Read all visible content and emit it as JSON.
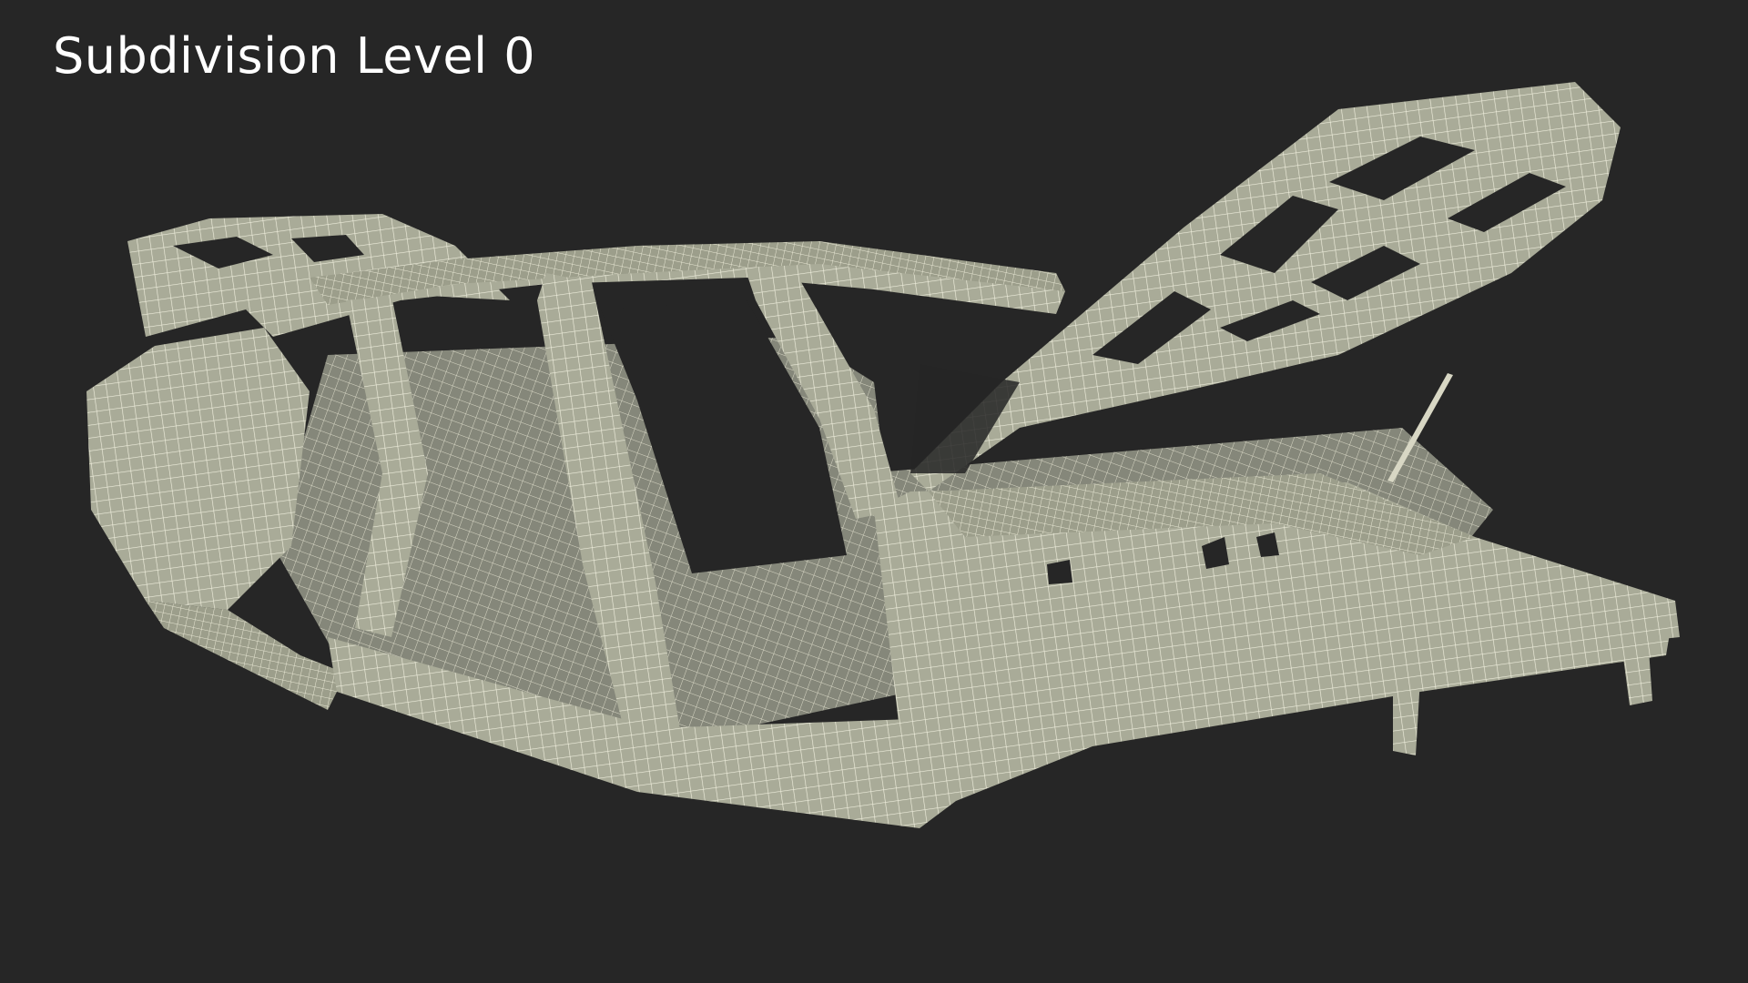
{
  "viewport": {
    "background": "#262626",
    "title": "Subdivision Level 0"
  },
  "model": {
    "subject": "car-body-in-white-wireframe",
    "surface_color": "#b9baa6",
    "wire_color": "#efeedd",
    "shadow_color": "#7d7f70"
  }
}
